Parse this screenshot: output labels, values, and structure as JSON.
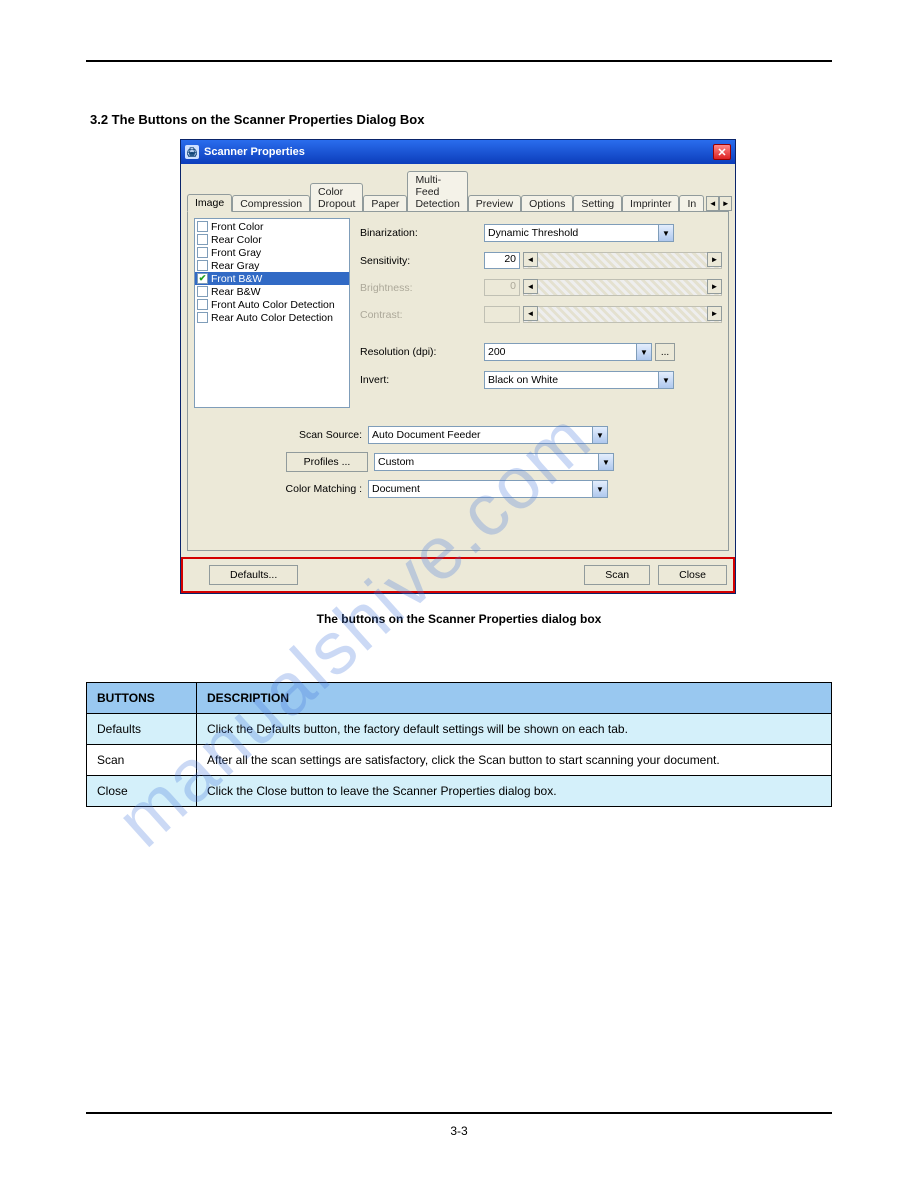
{
  "header": {
    "left": "",
    "right": ""
  },
  "section": {
    "title": "3.2 The Buttons on the Scanner Properties Dialog Box",
    "text": ""
  },
  "dialog": {
    "title": "Scanner Properties",
    "tabs": [
      "Image",
      "Compression",
      "Color Dropout",
      "Paper",
      "Multi-Feed Detection",
      "Preview",
      "Options",
      "Setting",
      "Imprinter",
      "In"
    ],
    "active_tab": 0,
    "selection": [
      {
        "label": "Front Color",
        "checked": false,
        "selected": false
      },
      {
        "label": "Rear Color",
        "checked": false,
        "selected": false
      },
      {
        "label": "Front Gray",
        "checked": false,
        "selected": false
      },
      {
        "label": "Rear Gray",
        "checked": false,
        "selected": false
      },
      {
        "label": "Front B&W",
        "checked": true,
        "selected": true
      },
      {
        "label": "Rear B&W",
        "checked": false,
        "selected": false
      },
      {
        "label": "Front Auto Color Detection",
        "checked": false,
        "selected": false
      },
      {
        "label": "Rear Auto Color Detection",
        "checked": false,
        "selected": false
      }
    ],
    "fields": {
      "binarization_label": "Binarization:",
      "binarization_value": "Dynamic Threshold",
      "sensitivity_label": "Sensitivity:",
      "sensitivity_value": "20",
      "brightness_label": "Brightness:",
      "brightness_value": "0",
      "contrast_label": "Contrast:",
      "contrast_value": "",
      "resolution_label": "Resolution (dpi):",
      "resolution_value": "200",
      "invert_label": "Invert:",
      "invert_value": "Black on White",
      "scan_source_label": "Scan Source:",
      "scan_source_value": "Auto Document Feeder",
      "profiles_btn": "Profiles ...",
      "profiles_value": "Custom",
      "color_matching_label": "Color Matching :",
      "color_matching_value": "Document"
    },
    "footer": {
      "defaults": "Defaults...",
      "scan": "Scan",
      "close": "Close"
    }
  },
  "caption": "The buttons on the Scanner Properties dialog box",
  "table": {
    "head": [
      "BUTTONS",
      "DESCRIPTION"
    ],
    "rows": [
      {
        "b": "Defaults",
        "d": "Click the Defaults button, the factory default settings will be shown on each tab."
      },
      {
        "b": "Scan",
        "d": "After all the scan settings are satisfactory, click the Scan button to start scanning your document."
      },
      {
        "b": "Close",
        "d": "Click the Close button to leave the Scanner Properties dialog box."
      }
    ]
  },
  "page_number": "3-3",
  "watermark": "manualshive.com"
}
